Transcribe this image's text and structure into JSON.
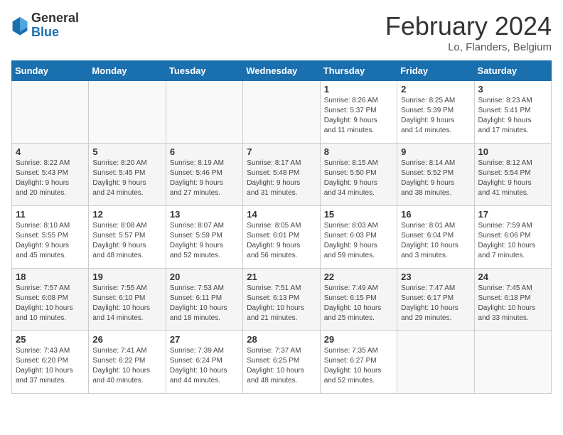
{
  "header": {
    "logo_general": "General",
    "logo_blue": "Blue",
    "title": "February 2024",
    "subtitle": "Lo, Flanders, Belgium"
  },
  "days_of_week": [
    "Sunday",
    "Monday",
    "Tuesday",
    "Wednesday",
    "Thursday",
    "Friday",
    "Saturday"
  ],
  "weeks": [
    [
      {
        "num": "",
        "info": ""
      },
      {
        "num": "",
        "info": ""
      },
      {
        "num": "",
        "info": ""
      },
      {
        "num": "",
        "info": ""
      },
      {
        "num": "1",
        "info": "Sunrise: 8:26 AM\nSunset: 5:37 PM\nDaylight: 9 hours\nand 11 minutes."
      },
      {
        "num": "2",
        "info": "Sunrise: 8:25 AM\nSunset: 5:39 PM\nDaylight: 9 hours\nand 14 minutes."
      },
      {
        "num": "3",
        "info": "Sunrise: 8:23 AM\nSunset: 5:41 PM\nDaylight: 9 hours\nand 17 minutes."
      }
    ],
    [
      {
        "num": "4",
        "info": "Sunrise: 8:22 AM\nSunset: 5:43 PM\nDaylight: 9 hours\nand 20 minutes."
      },
      {
        "num": "5",
        "info": "Sunrise: 8:20 AM\nSunset: 5:45 PM\nDaylight: 9 hours\nand 24 minutes."
      },
      {
        "num": "6",
        "info": "Sunrise: 8:19 AM\nSunset: 5:46 PM\nDaylight: 9 hours\nand 27 minutes."
      },
      {
        "num": "7",
        "info": "Sunrise: 8:17 AM\nSunset: 5:48 PM\nDaylight: 9 hours\nand 31 minutes."
      },
      {
        "num": "8",
        "info": "Sunrise: 8:15 AM\nSunset: 5:50 PM\nDaylight: 9 hours\nand 34 minutes."
      },
      {
        "num": "9",
        "info": "Sunrise: 8:14 AM\nSunset: 5:52 PM\nDaylight: 9 hours\nand 38 minutes."
      },
      {
        "num": "10",
        "info": "Sunrise: 8:12 AM\nSunset: 5:54 PM\nDaylight: 9 hours\nand 41 minutes."
      }
    ],
    [
      {
        "num": "11",
        "info": "Sunrise: 8:10 AM\nSunset: 5:55 PM\nDaylight: 9 hours\nand 45 minutes."
      },
      {
        "num": "12",
        "info": "Sunrise: 8:08 AM\nSunset: 5:57 PM\nDaylight: 9 hours\nand 48 minutes."
      },
      {
        "num": "13",
        "info": "Sunrise: 8:07 AM\nSunset: 5:59 PM\nDaylight: 9 hours\nand 52 minutes."
      },
      {
        "num": "14",
        "info": "Sunrise: 8:05 AM\nSunset: 6:01 PM\nDaylight: 9 hours\nand 56 minutes."
      },
      {
        "num": "15",
        "info": "Sunrise: 8:03 AM\nSunset: 6:03 PM\nDaylight: 9 hours\nand 59 minutes."
      },
      {
        "num": "16",
        "info": "Sunrise: 8:01 AM\nSunset: 6:04 PM\nDaylight: 10 hours\nand 3 minutes."
      },
      {
        "num": "17",
        "info": "Sunrise: 7:59 AM\nSunset: 6:06 PM\nDaylight: 10 hours\nand 7 minutes."
      }
    ],
    [
      {
        "num": "18",
        "info": "Sunrise: 7:57 AM\nSunset: 6:08 PM\nDaylight: 10 hours\nand 10 minutes."
      },
      {
        "num": "19",
        "info": "Sunrise: 7:55 AM\nSunset: 6:10 PM\nDaylight: 10 hours\nand 14 minutes."
      },
      {
        "num": "20",
        "info": "Sunrise: 7:53 AM\nSunset: 6:11 PM\nDaylight: 10 hours\nand 18 minutes."
      },
      {
        "num": "21",
        "info": "Sunrise: 7:51 AM\nSunset: 6:13 PM\nDaylight: 10 hours\nand 21 minutes."
      },
      {
        "num": "22",
        "info": "Sunrise: 7:49 AM\nSunset: 6:15 PM\nDaylight: 10 hours\nand 25 minutes."
      },
      {
        "num": "23",
        "info": "Sunrise: 7:47 AM\nSunset: 6:17 PM\nDaylight: 10 hours\nand 29 minutes."
      },
      {
        "num": "24",
        "info": "Sunrise: 7:45 AM\nSunset: 6:18 PM\nDaylight: 10 hours\nand 33 minutes."
      }
    ],
    [
      {
        "num": "25",
        "info": "Sunrise: 7:43 AM\nSunset: 6:20 PM\nDaylight: 10 hours\nand 37 minutes."
      },
      {
        "num": "26",
        "info": "Sunrise: 7:41 AM\nSunset: 6:22 PM\nDaylight: 10 hours\nand 40 minutes."
      },
      {
        "num": "27",
        "info": "Sunrise: 7:39 AM\nSunset: 6:24 PM\nDaylight: 10 hours\nand 44 minutes."
      },
      {
        "num": "28",
        "info": "Sunrise: 7:37 AM\nSunset: 6:25 PM\nDaylight: 10 hours\nand 48 minutes."
      },
      {
        "num": "29",
        "info": "Sunrise: 7:35 AM\nSunset: 6:27 PM\nDaylight: 10 hours\nand 52 minutes."
      },
      {
        "num": "",
        "info": ""
      },
      {
        "num": "",
        "info": ""
      }
    ]
  ]
}
